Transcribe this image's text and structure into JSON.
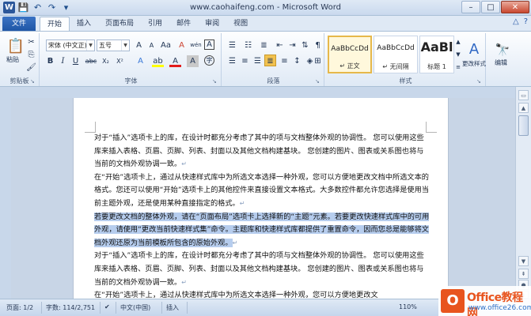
{
  "window": {
    "title": "www.caohaifeng.com - Microsoft Word",
    "minimize": "–",
    "maximize": "□",
    "close": "✕"
  },
  "quick_access": {
    "logo": "W",
    "save_icon": "💾",
    "undo_icon": "↶",
    "redo_icon": "↷",
    "customize_icon": "▾"
  },
  "tabs": {
    "file": "文件",
    "items": [
      "开始",
      "插入",
      "页面布局",
      "引用",
      "邮件",
      "审阅",
      "视图"
    ],
    "active_index": 0,
    "help_icon": "?",
    "minimize_ribbon_icon": "△"
  },
  "ribbon": {
    "clipboard": {
      "label": "剪贴板",
      "paste": "粘贴"
    },
    "font": {
      "label": "字体",
      "font_name": "宋体 (中文正)",
      "font_size": "五号",
      "bold": "B",
      "italic": "I",
      "underline": "U",
      "strike": "abc",
      "subscript": "X₂",
      "superscript": "X²",
      "grow": "A",
      "shrink": "A",
      "change_case": "Aa",
      "clear": "A",
      "phonetic": "wén",
      "border_char": "A",
      "effects": "A",
      "highlight": "ab",
      "color": "A",
      "shading": "A",
      "enclose": "字"
    },
    "paragraph": {
      "label": "段落"
    },
    "styles": {
      "label": "样式",
      "items": [
        {
          "sample": "AaBbCcDd",
          "name": "↵ 正文"
        },
        {
          "sample": "AaBbCcDd",
          "name": "↵ 无间隔"
        },
        {
          "sample": "AaBl",
          "name": "标题 1"
        }
      ],
      "change_styles": "更改样式"
    },
    "editing": {
      "label": "编辑"
    }
  },
  "document": {
    "paragraphs": [
      {
        "text": "对于“插入”选项卡上的库，在设计时都充分考虑了其中的项与文档整体外观的协调性。 您可以使用这些库来插入表格、页眉、页脚、列表、封面以及其他文档构建基块。 您创建的图片、图表或关系图也将与当前的文档外观协调一致。",
        "highlight": false
      },
      {
        "text": "在“开始”选项卡上，通过从快速样式库中为所选文本选择一种外观，您可以方便地更改文档中所选文本的格式。您还可以使用“开始”选项卡上的其他控件来直接设置文本格式。大多数控件都允许您选择是使用当前主题外观，还是使用某种直接指定的格式。",
        "highlight": false
      },
      {
        "text": "若要更改文档的整体外观，请在“页面布局”选项卡上选择新的“主题”元素。若要更改快速样式库中的可用外观，请使用“更改当前快速样式集”命令。主题库和快速样式库都提供了重置命令，因而您总是能够将文档外观还原为当前模板所包含的原始外观。",
        "highlight": true
      },
      {
        "text": "对于“插入”选项卡上的库，在设计时都充分考虑了其中的项与文档整体外观的协调性。 您可以使用这些库来插入表格、页眉、页脚、列表、封面以及其他文档构建基块。 您创建的图片、图表或关系图也将与当前的文档外观协调一致。",
        "highlight": false
      },
      {
        "text": "在“开始”选项卡上，通过从快速样式库中为所选文本选择一种外观，您可以方便地更改文",
        "highlight": false
      }
    ],
    "para_mark": "↵"
  },
  "status": {
    "page": "页面: 1/2",
    "words": "字数: 114/2,751",
    "language": "中文(中国)",
    "mode": "插入",
    "zoom": "110%"
  },
  "watermark": {
    "badge": "O",
    "line1": "Office教程网",
    "line2": "www.office26.com"
  },
  "colors": {
    "accent": "#2b579a",
    "selection": "#b6cdee",
    "ribbon_bg": "#dfe9f5"
  }
}
